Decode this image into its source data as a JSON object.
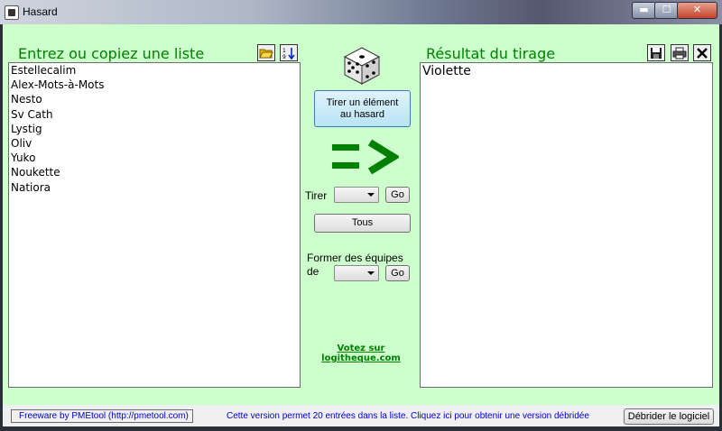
{
  "window": {
    "title": "Hasard",
    "min_glyph": "▬",
    "max_glyph": "☐",
    "close_glyph": "✕"
  },
  "left_panel": {
    "heading": "Entrez ou copiez une liste",
    "items": [
      "Estellecalim",
      "Alex-Mots-à-Mots",
      "Nesto",
      "Sv Cath",
      "Lystig",
      "Oliv",
      "Yuko",
      "Noukette",
      "Natiora"
    ],
    "icons": [
      "open-folder-icon",
      "sort-icon"
    ]
  },
  "center": {
    "draw_button": "Tirer un élément au hasard",
    "draw_label": "Tirer",
    "draw_go": "Go",
    "all_button": "Tous",
    "teams_label_line1": "Former des équipes",
    "teams_label_line2": "de",
    "teams_go": "Go",
    "vote_link": "Votez sur logitheque.com",
    "accent_color": "#008000"
  },
  "right_panel": {
    "heading": "Résultat du tirage",
    "result": "Violette",
    "icons": [
      "save-icon",
      "print-icon",
      "clear-icon"
    ]
  },
  "status": {
    "freeware": "Freeware by PMEtool (http://pmetool.com)",
    "version_note": "Cette version permet 20 entrées dans la liste. Cliquez ici pour obtenir une version débridée",
    "unlock_button": "Débrider le logiciel"
  }
}
